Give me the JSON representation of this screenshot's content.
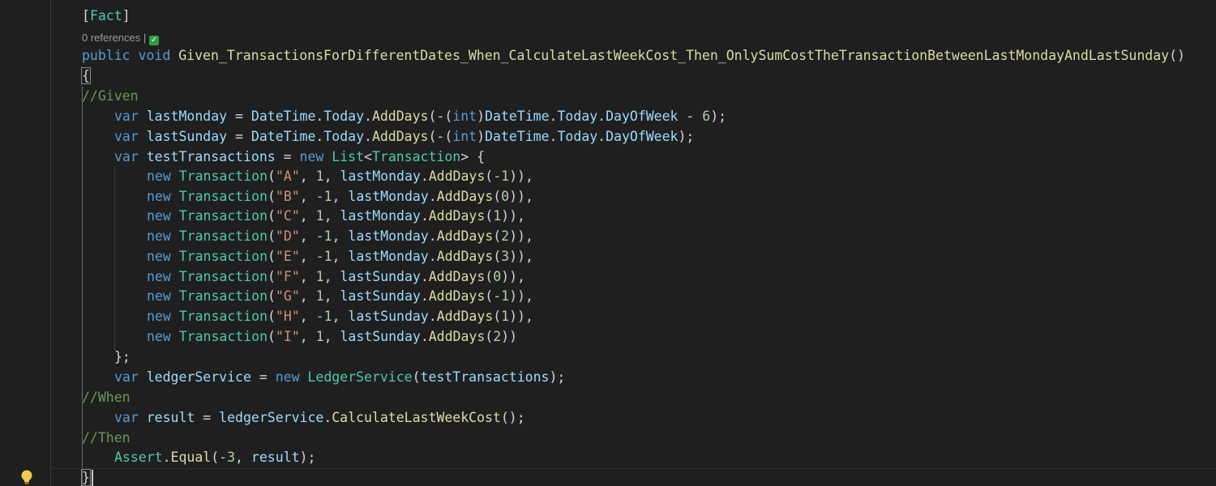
{
  "editor": {
    "codelens": {
      "references_label": "0 references |",
      "status_icon": "check-icon"
    },
    "line_01": {
      "text": "[Fact]"
    },
    "line_02": {
      "kw_public": "public",
      "kw_void": "void",
      "method_name": "Given_TransactionsForDifferentDates_When_CalculateLastWeekCost_Then_OnlySumCostTheTransactionBetweenLastMondayAndLastSunday",
      "parens": "()"
    },
    "line_03": {
      "text": "{"
    },
    "line_04": {
      "text": "//Given"
    },
    "line_05": {
      "var": "var",
      "name": "lastMonday",
      "rest_pre": " = ",
      "type1": "DateTime",
      "m1": "Today",
      "m2": "AddDays",
      "rest_mid": "(-(",
      "kw_int": "int",
      "rest_mid2": ")",
      "type2": "DateTime",
      "m3": "Today",
      "m4": "DayOfWeek",
      "rest_post": " - ",
      "num": "6",
      "rest_end": ");"
    },
    "line_06": {
      "var": "var",
      "name": "lastSunday",
      "rest_pre": " = ",
      "type1": "DateTime",
      "m1": "Today",
      "m2": "AddDays",
      "rest_mid": "(-(",
      "kw_int": "int",
      "rest_mid2": ")",
      "type2": "DateTime",
      "m3": "Today",
      "m4": "DayOfWeek",
      "rest_end": ");"
    },
    "line_07": {
      "var": "var",
      "name": "testTransactions",
      "op": " = ",
      "kw_new": "new",
      "type_list": "List",
      "lt": "<",
      "type_tx": "Transaction",
      "gt": "> {"
    },
    "transactions": [
      {
        "kw": "new",
        "type": "Transaction",
        "label": "\"A\"",
        "amount": "1",
        "anchor": "lastMonday",
        "method": "AddDays",
        "offset": "-1",
        "tail": ")),"
      },
      {
        "kw": "new",
        "type": "Transaction",
        "label": "\"B\"",
        "amount": "-1",
        "anchor": "lastMonday",
        "method": "AddDays",
        "offset": "0",
        "tail": ")),"
      },
      {
        "kw": "new",
        "type": "Transaction",
        "label": "\"C\"",
        "amount": "1",
        "anchor": "lastMonday",
        "method": "AddDays",
        "offset": "1",
        "tail": ")),"
      },
      {
        "kw": "new",
        "type": "Transaction",
        "label": "\"D\"",
        "amount": "-1",
        "anchor": "lastMonday",
        "method": "AddDays",
        "offset": "2",
        "tail": ")),"
      },
      {
        "kw": "new",
        "type": "Transaction",
        "label": "\"E\"",
        "amount": "-1",
        "anchor": "lastMonday",
        "method": "AddDays",
        "offset": "3",
        "tail": ")),"
      },
      {
        "kw": "new",
        "type": "Transaction",
        "label": "\"F\"",
        "amount": "1",
        "anchor": "lastSunday",
        "method": "AddDays",
        "offset": "0",
        "tail": ")),"
      },
      {
        "kw": "new",
        "type": "Transaction",
        "label": "\"G\"",
        "amount": "1",
        "anchor": "lastSunday",
        "method": "AddDays",
        "offset": "-1",
        "tail": ")),"
      },
      {
        "kw": "new",
        "type": "Transaction",
        "label": "\"H\"",
        "amount": "-1",
        "anchor": "lastSunday",
        "method": "AddDays",
        "offset": "1",
        "tail": ")),"
      },
      {
        "kw": "new",
        "type": "Transaction",
        "label": "\"I\"",
        "amount": "1",
        "anchor": "lastSunday",
        "method": "AddDays",
        "offset": "2",
        "tail": "))"
      }
    ],
    "line_17": {
      "text": "};"
    },
    "line_18": {
      "var": "var",
      "name": "ledgerService",
      "op": " = ",
      "kw_new": "new",
      "type": "LedgerService",
      "open": "(",
      "arg": "testTransactions",
      "close": ");"
    },
    "line_19": {
      "text": "//When"
    },
    "line_20": {
      "var": "var",
      "name": "result",
      "op": " = ",
      "obj": "ledgerService",
      "method": "CalculateLastWeekCost",
      "close": "();"
    },
    "line_21": {
      "text": "//Then"
    },
    "line_22": {
      "type": "Assert",
      "method": "Equal",
      "open": "(",
      "num": "-3",
      "sep": ", ",
      "arg": "result",
      "close": ");"
    },
    "line_23": {
      "text": "}"
    },
    "gutter": {
      "lightbulb_icon": "lightbulb-icon"
    },
    "colors": {
      "background": "#1f1f1f",
      "keyword": "#569cd6",
      "type": "#4ec9b0",
      "method": "#dcdcaa",
      "variable": "#9cdcfe",
      "string": "#ce9178",
      "number": "#b5cea8",
      "comment": "#6a9955",
      "lightbulb": "#f2c94c"
    }
  }
}
